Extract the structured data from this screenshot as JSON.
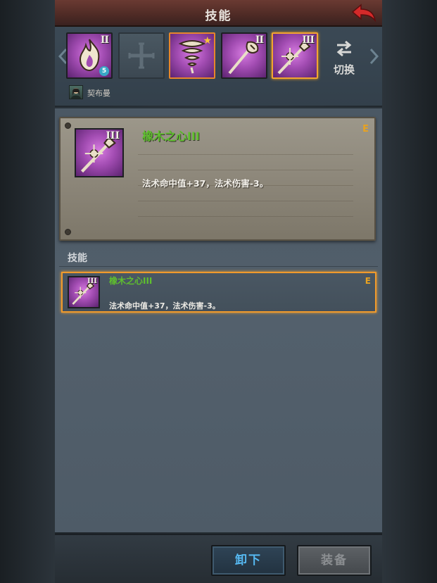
{
  "header": {
    "title": "技能",
    "back_icon": "back-arrow-icon"
  },
  "skill_bar": {
    "slots": [
      {
        "icon": "flame-skill-icon",
        "rank": "II",
        "level": "5",
        "state": "normal"
      },
      {
        "icon": "empty-slot-cross-icon",
        "rank": "",
        "state": "empty"
      },
      {
        "icon": "tornado-skill-icon",
        "rank": "",
        "starred": true,
        "state": "orange-border"
      },
      {
        "icon": "nature-staff-skill-icon",
        "rank": "II",
        "state": "normal"
      },
      {
        "icon": "oak-heart-staff-skill-icon",
        "rank": "III",
        "state": "selected"
      }
    ],
    "switch_label": "切换",
    "hero_name": "契布曼"
  },
  "detail": {
    "name": "橡木之心III",
    "rank": "III",
    "grade": "E",
    "description": "法术命中值+37，法术伤害-3。"
  },
  "section": {
    "title": "技能"
  },
  "skill_list": [
    {
      "name": "橡木之心III",
      "rank": "III",
      "grade": "E",
      "description": "法术命中值+37，法术伤害-3。"
    }
  ],
  "buttons": {
    "unequip": "卸下",
    "equip": "装备"
  },
  "colors": {
    "skill_name_green": "#5fbf2e",
    "grade_orange": "#e8a221",
    "selection_orange": "#f09a2c",
    "unequip_blue": "#56b9f2"
  }
}
